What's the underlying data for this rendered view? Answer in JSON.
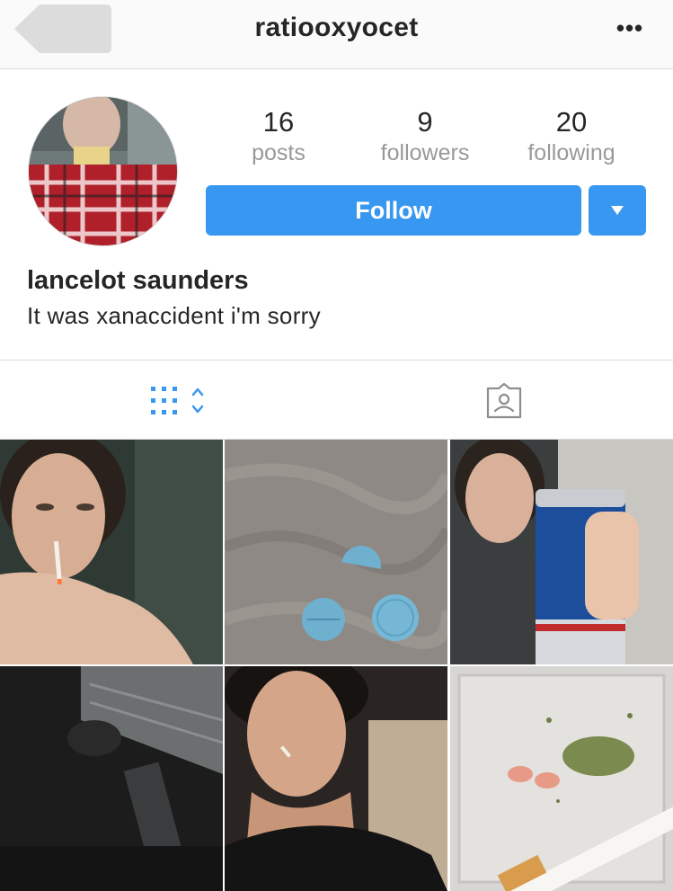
{
  "header": {
    "username": "ratiooxyocet",
    "back_icon": "back-arrow-icon",
    "more_icon": "more-options-icon",
    "more_label": "•••"
  },
  "profile": {
    "full_name": "lancelot saunders",
    "bio": "It was xanaccident i'm sorry",
    "stats": {
      "posts": {
        "value": "16",
        "label": "posts"
      },
      "followers": {
        "value": "9",
        "label": "followers"
      },
      "following": {
        "value": "20",
        "label": "following"
      }
    },
    "follow_label": "Follow",
    "dropdown_icon": "caret-down-icon"
  },
  "tabs": [
    {
      "name": "grid",
      "icon": "grid-view-icon",
      "active": true
    },
    {
      "name": "tagged",
      "icon": "tagged-photos-icon",
      "active": false
    }
  ],
  "posts": [
    {
      "index": 1
    },
    {
      "index": 2
    },
    {
      "index": 3
    },
    {
      "index": 4
    },
    {
      "index": 5
    },
    {
      "index": 6
    }
  ],
  "colors": {
    "accent": "#3897f0",
    "text": "#262626",
    "muted": "#999999",
    "border": "#dbdbdb",
    "topbar": "#fafafa"
  }
}
